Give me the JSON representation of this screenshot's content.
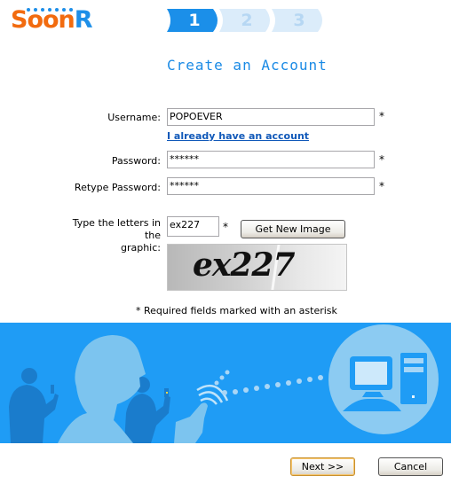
{
  "brand": {
    "logo_prefix": "Soon",
    "logo_suffix": "R",
    "primary_color": "#f26b0f",
    "accent_color": "#1e8fe8"
  },
  "wizard": {
    "steps": [
      {
        "label": "1",
        "state": "active"
      },
      {
        "label": "2",
        "state": "inactive"
      },
      {
        "label": "3",
        "state": "inactive"
      }
    ]
  },
  "page": {
    "title": "Create an Account"
  },
  "form": {
    "username": {
      "label": "Username:",
      "value": "POPOEVER",
      "required_mark": "*"
    },
    "existing_account_link": "I already have an account",
    "password": {
      "label": "Password:",
      "value": "******",
      "required_mark": "*"
    },
    "retype_password": {
      "label": "Retype Password:",
      "value": "******",
      "required_mark": "*"
    },
    "captcha": {
      "label_line1": "Type the letters in the",
      "label_line2": "graphic:",
      "value": "ex227",
      "required_mark": "*",
      "new_image_button": "Get New Image",
      "image_text": "ex227",
      "image_icon": "captcha-image"
    },
    "required_note": "* Required fields marked with an asterisk"
  },
  "banner": {
    "illustration": "people-with-phones-syncing-to-computer"
  },
  "footer": {
    "next_button": "Next >>",
    "cancel_button": "Cancel"
  }
}
